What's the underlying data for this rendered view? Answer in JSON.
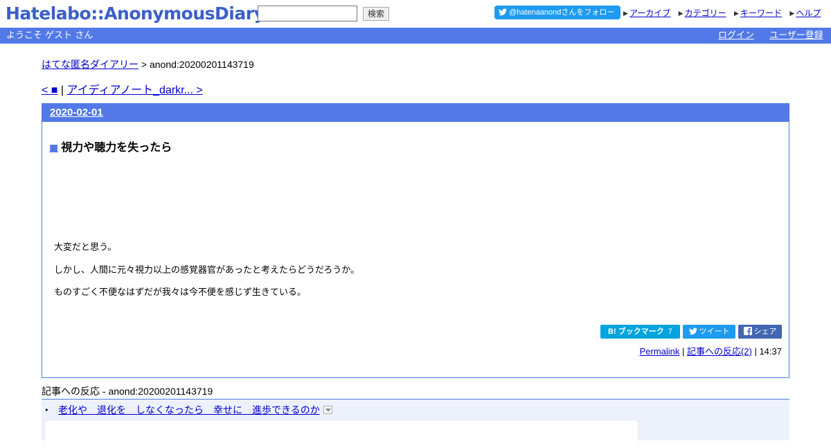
{
  "header": {
    "logo": "Hatelabo::AnonymousDiary",
    "search_placeholder": "",
    "search_button": "検索",
    "follow_button": "@hatenaanondさんをフォロー",
    "links": [
      {
        "label": "アーカイブ",
        "icon": "triangle-right-icon"
      },
      {
        "label": "カテゴリー",
        "icon": "triangle-right-icon"
      },
      {
        "label": "キーワード",
        "icon": "triangle-right-icon"
      },
      {
        "label": "ヘルプ",
        "icon": "triangle-right-icon"
      }
    ]
  },
  "userbar": {
    "welcome": "ようこそ ゲスト さん",
    "login": "ログイン",
    "register": "ユーザー登録"
  },
  "breadcrumb": {
    "home": "はてな匿名ダイアリー",
    "separator": " > ",
    "current": "anond:20200201143719"
  },
  "pager": {
    "prev": "< ■",
    "separator": " | ",
    "next": "アイディアノート_darkr... >"
  },
  "entry": {
    "date": "2020-02-01",
    "title_marker": "■",
    "title": "視力や聴力を失ったら",
    "body": [
      "大変だと思う。",
      "しかし、人間に元々視力以上の感覚器官があったと考えたらどうだろうか。",
      "ものすごく不便なはずだが我々は今不便を感じず生きている。"
    ],
    "share": {
      "bookmark_label": "ブックマーク",
      "bookmark_prefix": "B!",
      "bookmark_count": "7",
      "tweet_label": "ツイート",
      "share_label": "シェア"
    },
    "meta": {
      "permalink": "Permalink",
      "sep": " | ",
      "reactions": "記事への反応(2)",
      "time": "14:37"
    }
  },
  "reactions": {
    "heading": "記事への反応 - anond:20200201143719",
    "items": [
      {
        "bullet": "•",
        "title": "老化や　退化を　しなくなったら　幸せに　進歩できるのか"
      }
    ]
  },
  "colors": {
    "brand_blue": "#5279e7",
    "logo_blue": "#3b5fc9",
    "twitter_blue": "#1d9bf0",
    "hatebu_blue": "#00a4de",
    "facebook_blue": "#4267b2"
  }
}
